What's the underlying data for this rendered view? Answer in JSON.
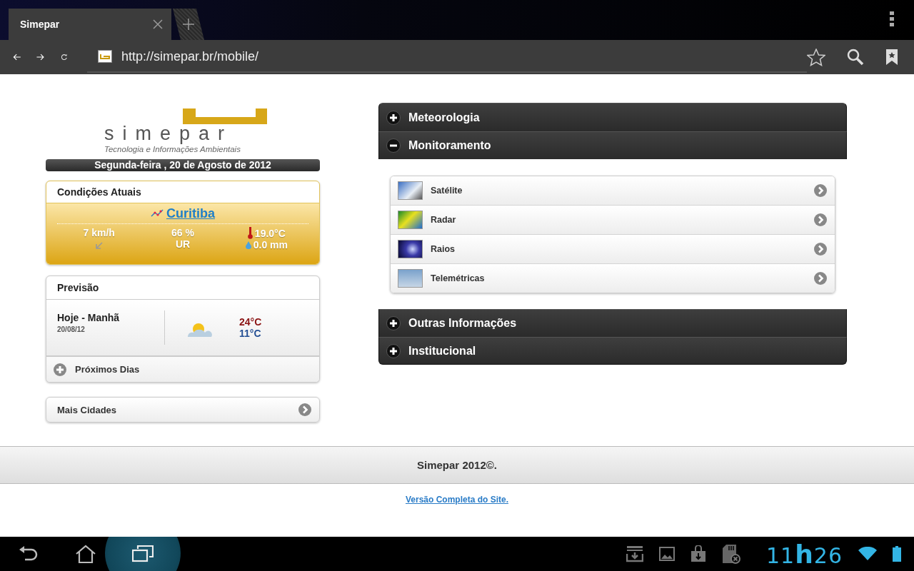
{
  "browser": {
    "tab": {
      "title": "Simepar"
    },
    "url": "http://simepar.br/mobile/"
  },
  "header": {
    "logo": "simepar",
    "tagline": "Tecnologia e Informações Ambientais",
    "date": "Segunda-feira , 20 de Agosto de 2012"
  },
  "current_conditions": {
    "title": "Condições Atuais",
    "city": "Curitiba",
    "wind": "7 km/h",
    "humidity": "66 %",
    "humidity_label": "UR",
    "temperature": "19.0°C",
    "rain": "0.0 mm"
  },
  "forecast": {
    "title": "Previsão",
    "period": "Hoje - Manhã",
    "date": "20/08/12",
    "max": "24°C",
    "min": "11°C",
    "more": {
      "label": "Próximos Dias",
      "expanded": false
    }
  },
  "more_cities": {
    "label": "Mais Cidades"
  },
  "menu": [
    {
      "label": "Meteorologia",
      "expanded": false
    },
    {
      "label": "Monitoramento",
      "expanded": true,
      "children": [
        {
          "label": "Satélite"
        },
        {
          "label": "Radar"
        },
        {
          "label": "Raios"
        },
        {
          "label": "Telemétricas"
        }
      ]
    },
    {
      "label": "Outras Informações",
      "expanded": false
    },
    {
      "label": "Institucional",
      "expanded": false
    }
  ],
  "footer": {
    "copyright": "Simepar 2012©.",
    "link": "Versão Completa do Site."
  },
  "status_bar": {
    "time": "11**h**26"
  }
}
